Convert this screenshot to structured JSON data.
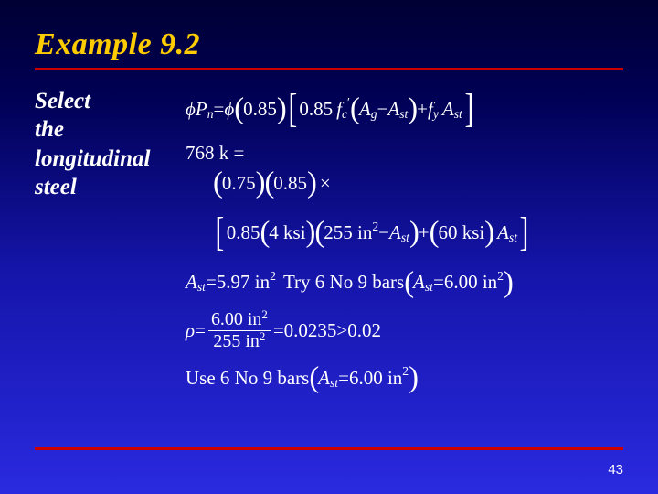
{
  "slide": {
    "title": "Example 9.2",
    "side_lines": [
      "Select",
      "the",
      "longitudinal",
      "steel"
    ],
    "page_number": "43"
  },
  "eq": {
    "row1": {
      "phiPn": "P",
      "phiPn_sub": "n",
      "eq": " = ",
      "outer_factor": "0.85",
      "inner_factor": "0.85",
      "fc": "f",
      "fc_sub": "c",
      "fc_sup": "′",
      "Ag": "A",
      "Ag_sub": "g",
      "minus": " − ",
      "Ast": "A",
      "Ast_sub": "st",
      "plus": " + ",
      "fy": "f",
      "fy_sub": "y",
      "Ast2": "A",
      "Ast2_sub": "st"
    },
    "row2": {
      "lhs": "768 k =",
      "fac1": "0.75",
      "fac2": "0.85"
    },
    "row3": {
      "inner_factor": "0.85",
      "ksi_val": "4 ksi",
      "area_val": "255 in",
      "area_sup": "2",
      "minus": " − ",
      "Ast": "A",
      "Ast_sub": "st",
      "plus": " + ",
      "fy_val": "60 ksi",
      "Ast2": "A",
      "Ast2_sub": "st"
    },
    "row4": {
      "Ast": "A",
      "Ast_sub": "st",
      "eq": " = ",
      "val": "5.97 in",
      "val_sup": "2",
      "try": "  Try 6 No 9 bars ",
      "Ast_res": "A",
      "Ast_res_sub": "st",
      "res_eq": " = ",
      "res_val": "6.00 in",
      "res_sup": "2"
    },
    "row5": {
      "num_val": "6.00 in",
      "num_sup": "2",
      "den_val": "255 in",
      "den_sup": "2",
      "eq": " = ",
      "calc": "0.0235",
      "gt": " > ",
      "limit": "0.02"
    },
    "row6": {
      "use": "Use 6 No 9 bars ",
      "Ast": "A",
      "Ast_sub": "st",
      "eq": " = ",
      "val": "6.00 in",
      "sup": "2"
    }
  }
}
